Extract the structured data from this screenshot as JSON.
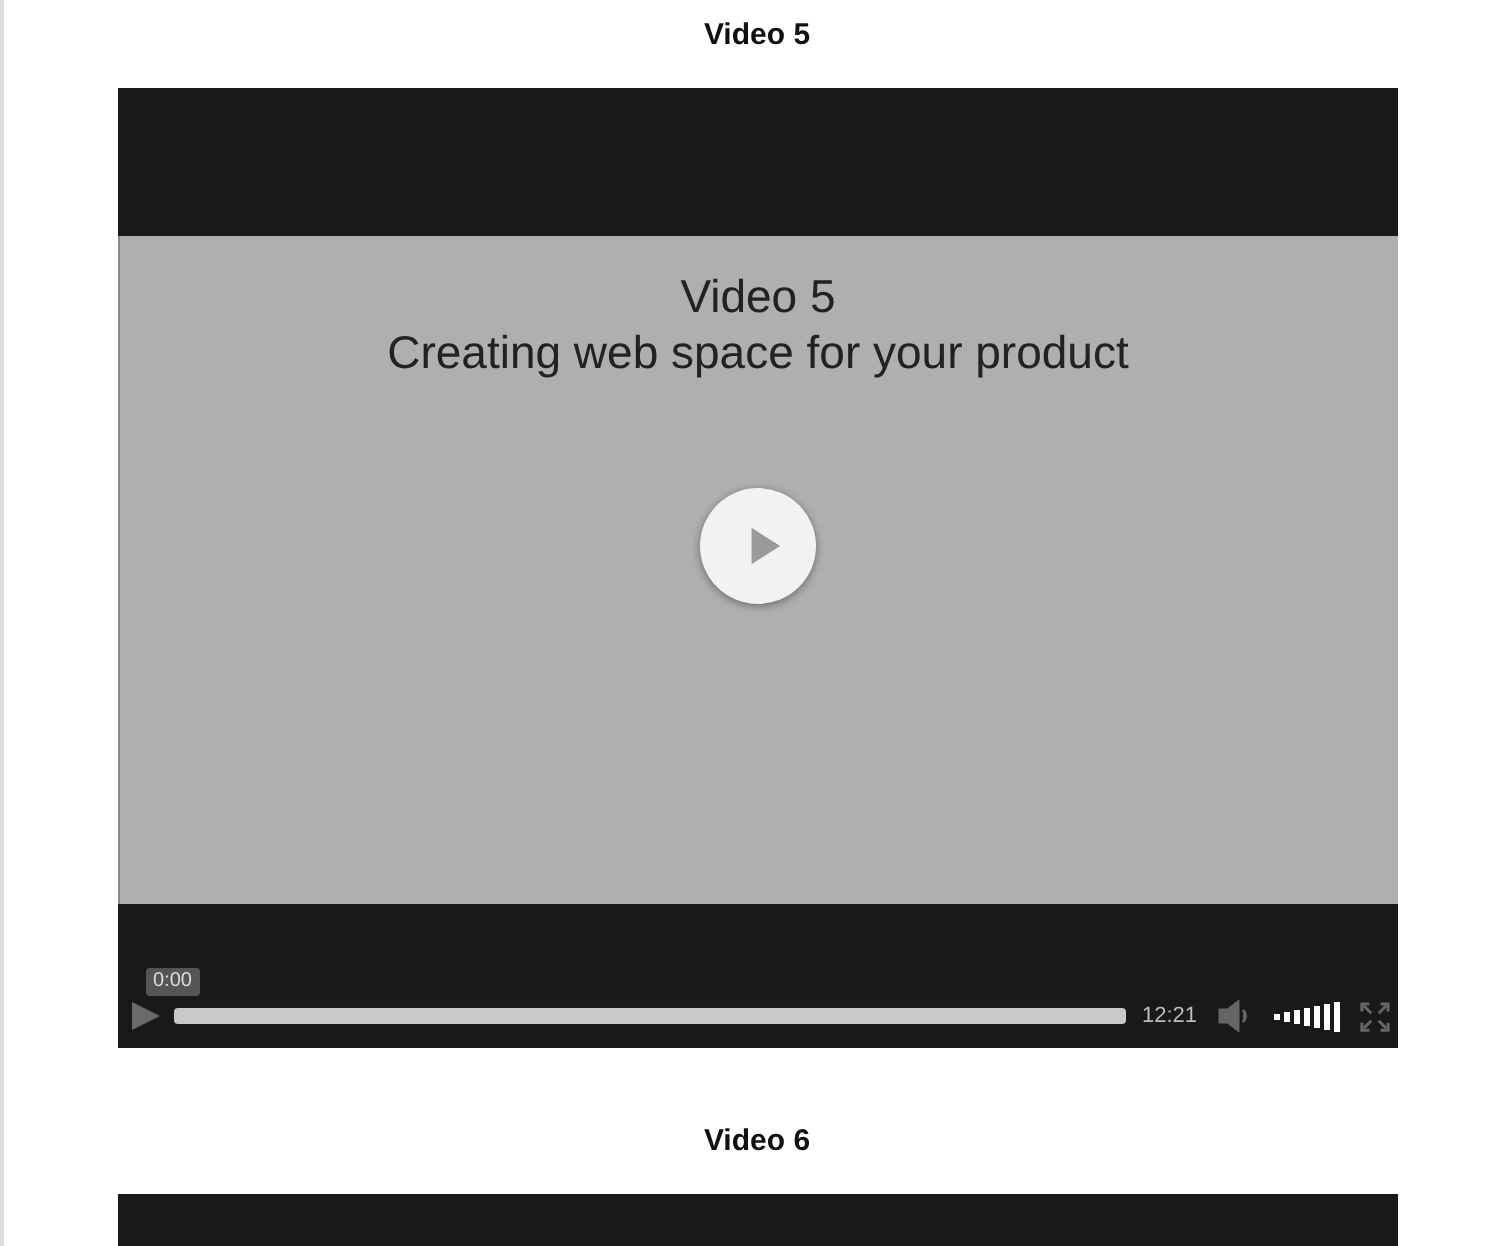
{
  "videos": [
    {
      "heading": "Video 5",
      "player": {
        "title_lines": [
          "Video 5",
          "Creating web space for your product"
        ],
        "time_tooltip": "0:00",
        "duration": "12:21"
      }
    },
    {
      "heading": "Video 6"
    }
  ]
}
